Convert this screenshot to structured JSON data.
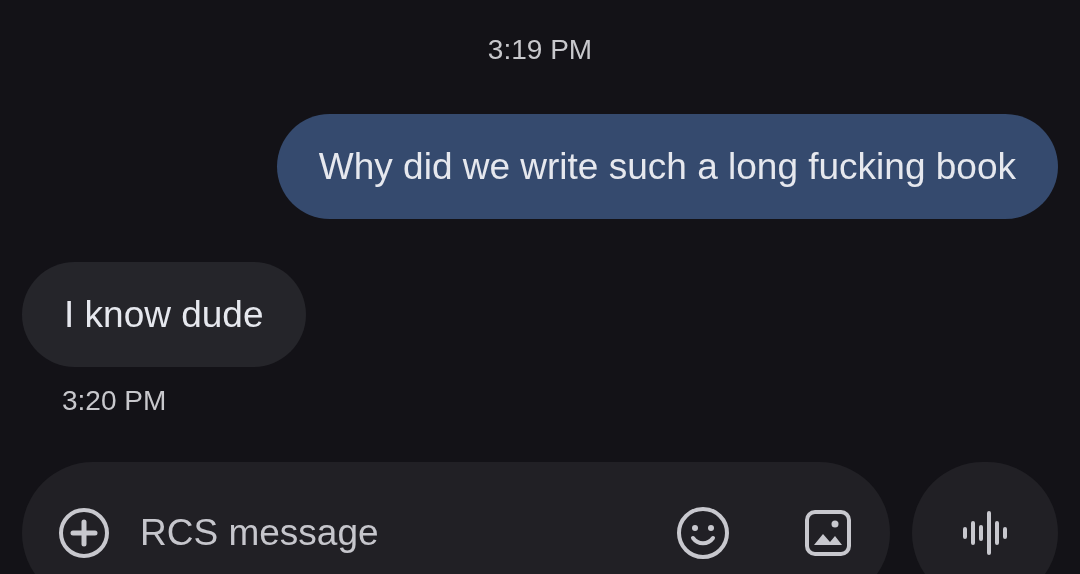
{
  "conversation": [
    {
      "kind": "timestamp",
      "text": "3:19 PM"
    },
    {
      "kind": "outgoing",
      "text": "Why did we write such a long fucking book"
    },
    {
      "kind": "incoming",
      "text": "I know dude"
    },
    {
      "kind": "meta",
      "text": "3:20 PM"
    }
  ],
  "composer": {
    "placeholder": "RCS message"
  }
}
